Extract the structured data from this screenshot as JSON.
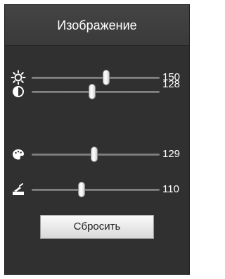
{
  "panel": {
    "title": "Изображение",
    "background": "#303030",
    "sliders": [
      {
        "name": "brightness",
        "icon": "brightness-sun-icon",
        "value": "150",
        "fraction": 0.58
      },
      {
        "name": "contrast",
        "icon": "contrast-half-circle-icon",
        "value": "128",
        "fraction": 0.47
      },
      {
        "name": "saturation",
        "icon": "color-palette-icon",
        "value": "129",
        "fraction": 0.49
      },
      {
        "name": "sharpness",
        "icon": "sharpness-edit-icon",
        "value": "110",
        "fraction": 0.39
      }
    ],
    "reset_label": "Сбросить"
  }
}
